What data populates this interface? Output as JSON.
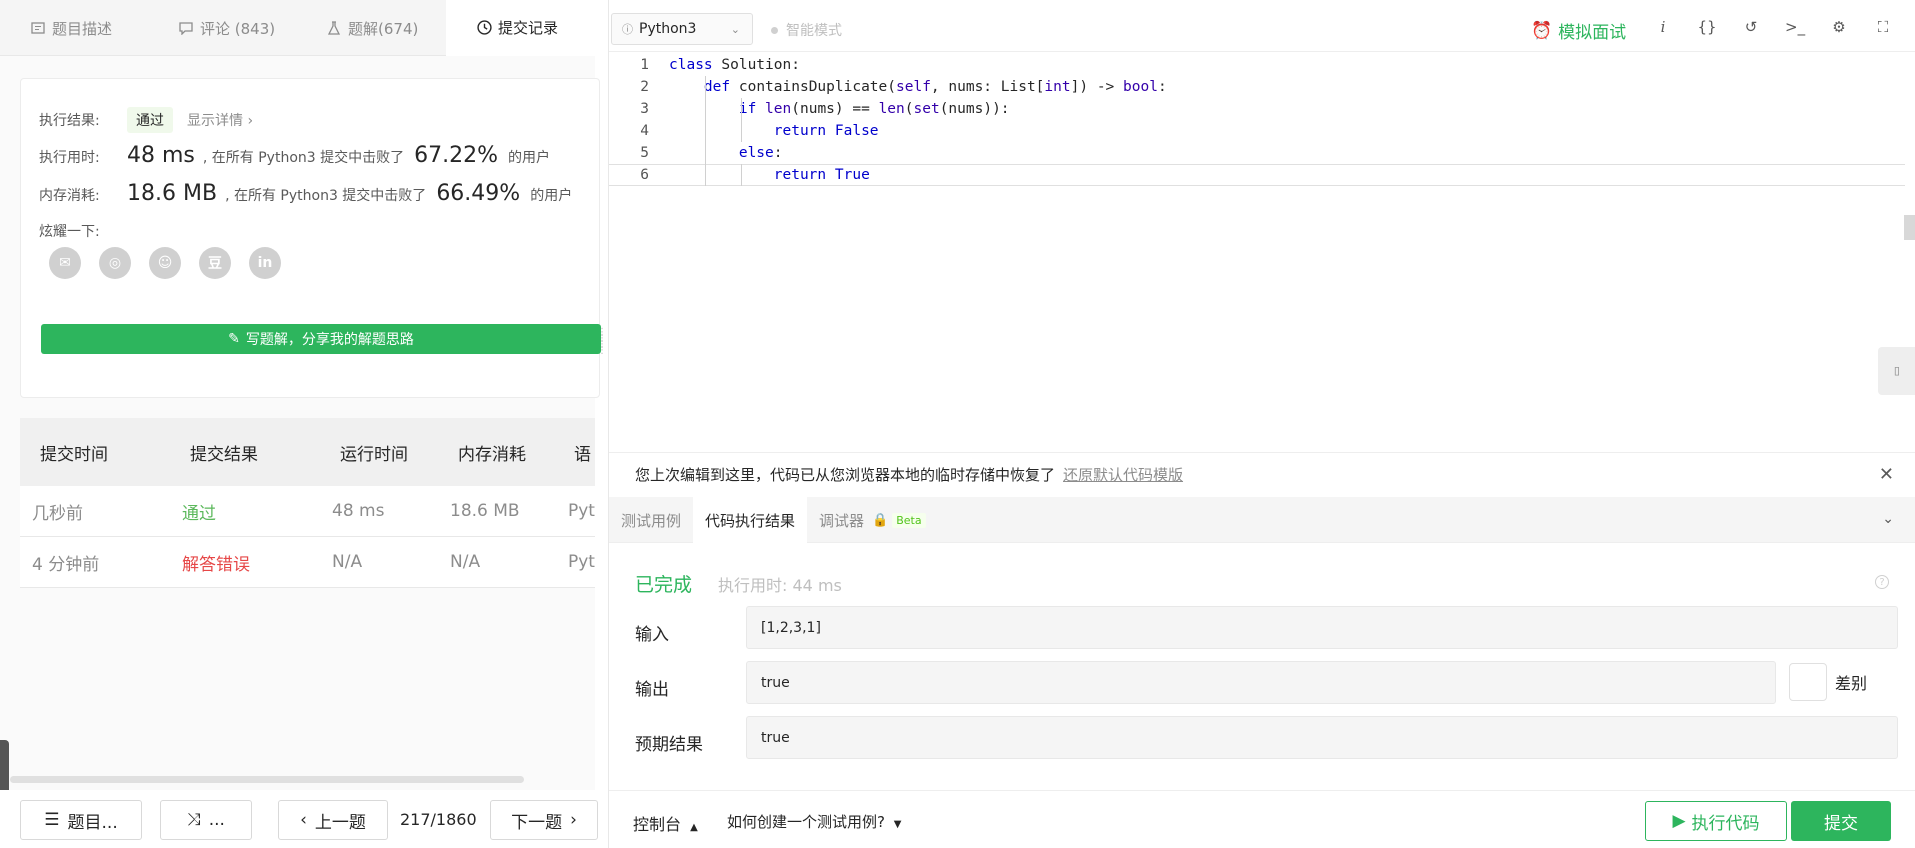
{
  "left_tabs": [
    {
      "label": "题目描述",
      "icon": "description-icon"
    },
    {
      "label": "评论 (843)",
      "icon": "comment-icon"
    },
    {
      "label": "题解(674)",
      "icon": "flask-icon"
    },
    {
      "label": "提交记录",
      "icon": "clock-icon"
    }
  ],
  "result": {
    "status_label": "执行结果:",
    "status_value": "通过",
    "detail_link": "显示详情 ›",
    "runtime_label": "执行用时:",
    "runtime_value": "48 ms",
    "runtime_mid": ", 在所有 Python3 提交中击败了",
    "runtime_pct": "67.22%",
    "runtime_suffix": "的用户",
    "memory_label": "内存消耗:",
    "memory_value": "18.6 MB",
    "memory_mid": ", 在所有 Python3 提交中击败了",
    "memory_pct": "66.49%",
    "memory_suffix": "的用户",
    "share_label": "炫耀一下:",
    "share_icons": [
      "wechat-icon",
      "weibo-icon",
      "qq-icon",
      "douban-icon",
      "linkedin-icon"
    ],
    "share_glyphs": [
      "✉",
      "◎",
      "☺",
      "豆",
      "in"
    ],
    "write_button": "写题解，分享我的解题思路"
  },
  "table": {
    "headers": [
      "提交时间",
      "提交结果",
      "运行时间",
      "内存消耗",
      "语"
    ],
    "rows": [
      {
        "time": "几秒前",
        "result": "通过",
        "runtime": "48 ms",
        "memory": "18.6 MB",
        "lang": "Pyt"
      },
      {
        "time": "4 分钟前",
        "result": "解答错误",
        "runtime": "N/A",
        "memory": "N/A",
        "lang": "Pyt"
      }
    ]
  },
  "bottom_left": {
    "list_button": "题目...",
    "random_button": "...",
    "prev_button": "上一题",
    "pager": "217/1860",
    "next_button": "下一题"
  },
  "toolbar": {
    "language": "Python3",
    "smart_mode": "智能模式",
    "mock_interview": "模拟面试"
  },
  "editor": {
    "lines": [
      {
        "num": "1",
        "indent": 0,
        "code": "class Solution:"
      },
      {
        "num": "2",
        "indent": 1,
        "code": "def containsDuplicate(self, nums: List[int]) -> bool:"
      },
      {
        "num": "3",
        "indent": 2,
        "code": "if len(nums) == len(set(nums)):"
      },
      {
        "num": "4",
        "indent": 3,
        "code": "return False"
      },
      {
        "num": "5",
        "indent": 2,
        "code": "else:"
      },
      {
        "num": "6",
        "indent": 3,
        "code": "return True"
      }
    ]
  },
  "notice": {
    "text": "您上次编辑到这里，代码已从您浏览器本地的临时存储中恢复了",
    "restore_link": "还原默认代码模版"
  },
  "result_tabs": [
    {
      "label": "测试用例"
    },
    {
      "label": "代码执行结果"
    },
    {
      "label": "调试器"
    }
  ],
  "beta_badge": "Beta",
  "run_result": {
    "status": "已完成",
    "time": "执行用时: 44 ms",
    "input_label": "输入",
    "input_value": "[1,2,3,1]",
    "output_label": "输出",
    "output_value": "true",
    "diff_label": "差别",
    "expected_label": "预期结果",
    "expected_value": "true"
  },
  "bottom_right": {
    "console": "控制台",
    "howto": "如何创建一个测试用例?",
    "run_button": "执行代码",
    "submit_button": "提交"
  },
  "colors": {
    "accent": "#2db55d",
    "error": "#e64747"
  }
}
